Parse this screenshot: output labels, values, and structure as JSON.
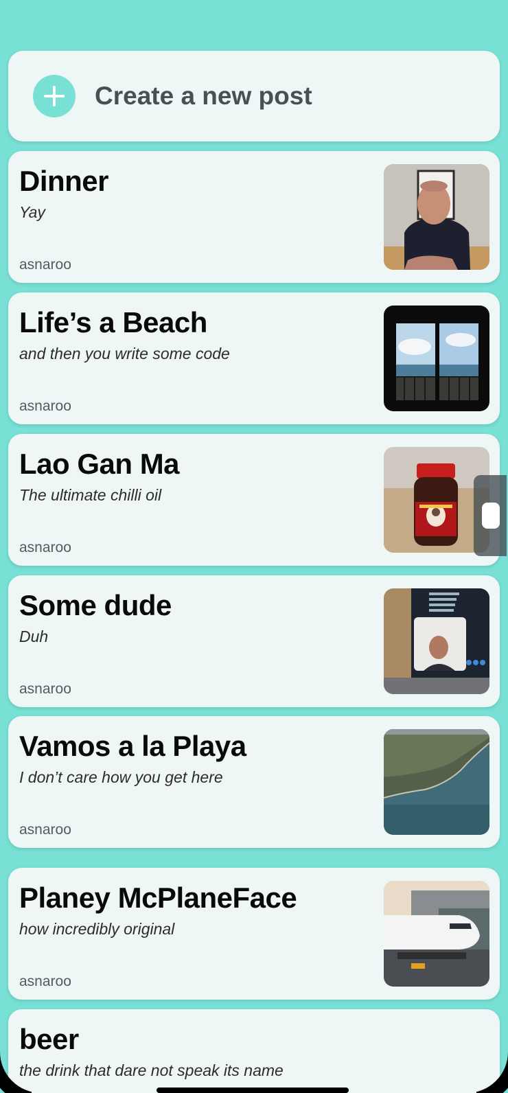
{
  "create_post": {
    "label": "Create a new post",
    "icon": "plus-circle-icon",
    "accent_color": "#78e0d4"
  },
  "posts": [
    {
      "title": "Dinner",
      "subtitle": "Yay",
      "author": "asnaroo",
      "image": "portrait-man-photo"
    },
    {
      "title": "Life’s a Beach",
      "subtitle": "and then you write some code",
      "author": "asnaroo",
      "image": "window-sea-view-photo"
    },
    {
      "title": "Lao Gan Ma",
      "subtitle": "The ultimate chilli oil",
      "author": "asnaroo",
      "image": "chilli-oil-jar-photo"
    },
    {
      "title": "Some dude",
      "subtitle": "Duh",
      "author": "asnaroo",
      "image": "laptop-video-call-photo"
    },
    {
      "title": "Vamos a la Playa",
      "subtitle": "I don’t care how you get here",
      "author": "asnaroo",
      "image": "aerial-coast-photo"
    },
    {
      "title": "Planey McPlaneFace",
      "subtitle": "how incredibly original",
      "author": "asnaroo",
      "image": "airplane-photo"
    },
    {
      "title": "beer",
      "subtitle": "the drink that dare not speak its name",
      "author": "asnaroo",
      "image": ""
    }
  ],
  "colors": {
    "background": "#78e0d4",
    "card": "#eef6f6",
    "title": "#0a0a0a",
    "author": "#555b5d"
  }
}
